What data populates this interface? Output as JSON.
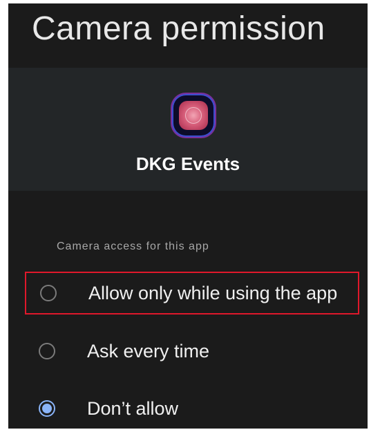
{
  "header": {
    "title": "Camera permission"
  },
  "app": {
    "name": "DKG Events",
    "icon": "dkg-events-app-icon"
  },
  "permission": {
    "section_label": "Camera access for this app",
    "options": [
      {
        "label": "Allow only while using the app",
        "selected": false,
        "highlighted": true
      },
      {
        "label": "Ask every time",
        "selected": false,
        "highlighted": false
      },
      {
        "label": "Don’t allow",
        "selected": true,
        "highlighted": false
      }
    ]
  },
  "colors": {
    "background": "#1b1b1b",
    "card": "#232628",
    "radio_selected": "#8ab4f8",
    "highlight_border": "#e0182b"
  }
}
